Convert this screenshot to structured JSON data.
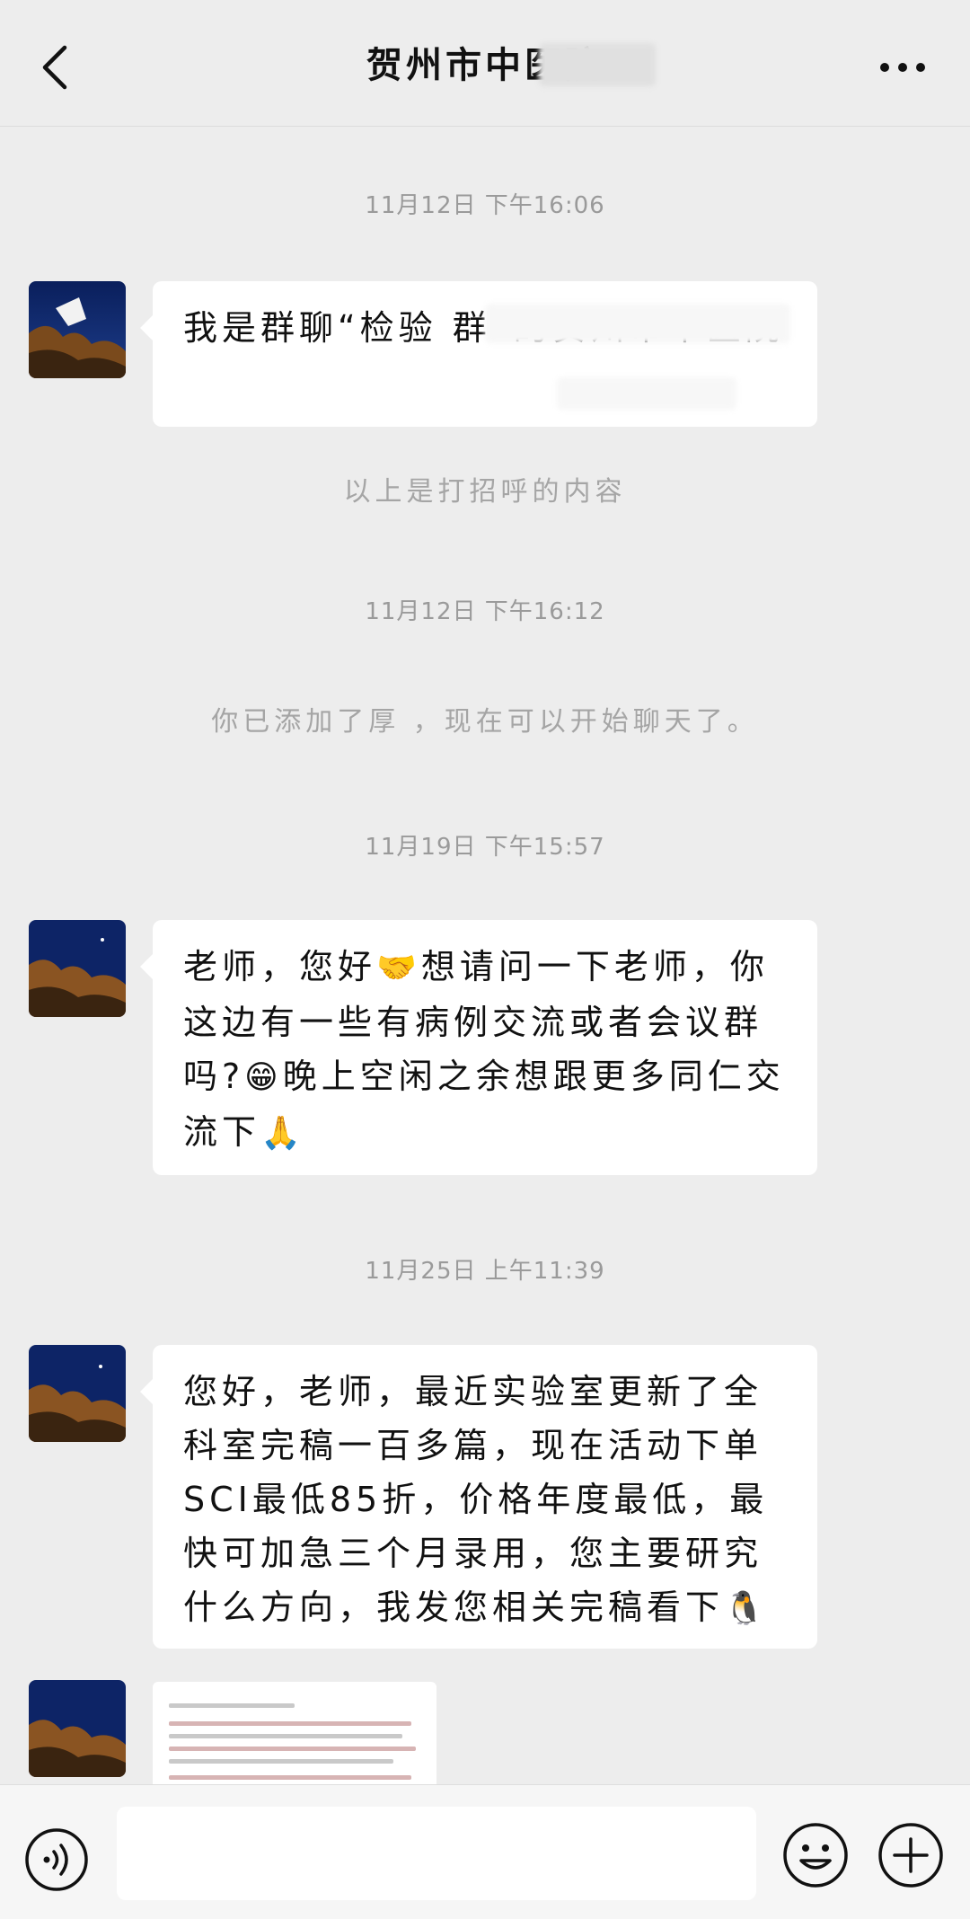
{
  "header": {
    "title": "贺州市中医院"
  },
  "messages": [
    {
      "time": "11月12日 下午16:06",
      "text": "我是群聊“检验 群”的贺州市中医院"
    },
    {
      "system": "以上是打招呼的内容"
    },
    {
      "time": "11月12日 下午16:12"
    },
    {
      "system": "你已添加了厚 ，现在可以开始聊天了。"
    },
    {
      "time": "11月19日 下午15:57",
      "text_a": "老师，您好",
      "text_b": "想请问一下老师，你这边有一些有病例交流或者会议群吗?",
      "text_c": "晚上空闲之余想跟更多同仁交流下"
    },
    {
      "time": "11月25日 上午11:39",
      "text": "您好，老师，最近实验室更新了全科室完稿一百多篇，现在活动下单SCI最低85折，价格年度最低，最快可加急三个月录用，您主要研究什么方向，我发您相关完稿看下"
    }
  ],
  "emojis": {
    "handshake": "🤝",
    "grin": "😁",
    "pray": "🙏",
    "penguin": "🐧"
  },
  "input": {
    "placeholder": ""
  },
  "icons": {
    "back": "chevron-left-icon",
    "more": "more-dots-icon",
    "voice": "voice-icon",
    "emoji": "emoji-face-icon",
    "plus": "plus-circle-icon"
  }
}
